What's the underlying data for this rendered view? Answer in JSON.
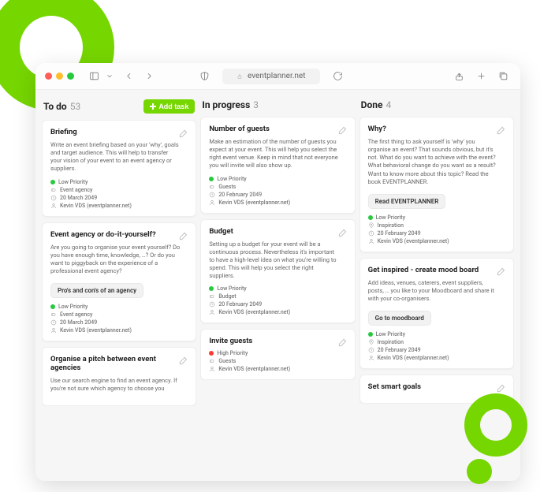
{
  "url": "eventplanner.net",
  "addTaskLabel": "Add task",
  "columns": [
    {
      "title": "To do",
      "count": 53,
      "showAdd": true,
      "cards": [
        {
          "title": "Briefing",
          "desc": "Write an event briefing based on your 'why', goals and target audience. This will help to transfer your vision of your event to an event agency or suppliers.",
          "priority": {
            "label": "Low Priority",
            "color": "green"
          },
          "tag": "Event agency",
          "date": "20 March 2049",
          "author": "Kevin VDS (eventplanner.net)"
        },
        {
          "title": "Event agency or do-it-yourself?",
          "desc": "Are you going to organise your event yourself? Do you have enough time, knowledge, …? Or do you want to piggyback on the experience of a professional event agency?",
          "action": "Pro's and con's of an agency",
          "priority": {
            "label": "Low Priority",
            "color": "green"
          },
          "tag": "Event agency",
          "date": "20 March 2049",
          "author": "Kevin VDS (eventplanner.net)"
        },
        {
          "title": "Organise a pitch between event agencies",
          "desc": "Use our search engine to find an event agency. If you're not sure which agency to choose you"
        }
      ]
    },
    {
      "title": "In progress",
      "count": 3,
      "showAdd": false,
      "cards": [
        {
          "title": "Number of guests",
          "desc": "Make an estimation of the number of guests you expect at your event. This will help you select the right event venue. Keep in mind that not everyone you will invite will also show up.",
          "priority": {
            "label": "Low Priority",
            "color": "green"
          },
          "tag": "Guests",
          "date": "20 February 2049",
          "author": "Kevin VDS (eventplanner.net)"
        },
        {
          "title": "Budget",
          "desc": "Setting up a budget for your event will be a continuous process. Nevertheless it's important to have a high-level idea on what you're willing to spend. This will help you select the right suppliers.",
          "priority": {
            "label": "Low Priority",
            "color": "green"
          },
          "tag": "Budget",
          "date": "20 February 2049",
          "author": "Kevin VDS (eventplanner.net)"
        },
        {
          "title": "Invite guests",
          "priority": {
            "label": "High Priority",
            "color": "red"
          },
          "tag": "Guests",
          "author": "Kevin VDS (eventplanner.net)"
        }
      ]
    },
    {
      "title": "Done",
      "count": 4,
      "showAdd": false,
      "cards": [
        {
          "title": "Why?",
          "desc": "The first thing to ask yourself is 'why' you organise an event? That sounds obvious, but it's not. What do you want to achieve with the event? What behavioral change do you want as a result? Want to know more about this topic? Read the book EVENTPLANNER.",
          "action": "Read EVENTPLANNER",
          "priority": {
            "label": "Low Priority",
            "color": "green"
          },
          "tag": "Inspiration",
          "date": "20 February 2049",
          "author": "Kevin VDS (eventplanner.net)"
        },
        {
          "title": "Get inspired - create mood board",
          "desc": "Add ideas, venues, caterers, event suppliers, posts, … you like to your Moodboard and share it with your co-organisers.",
          "action": "Go to moodboard",
          "priority": {
            "label": "Low Priority",
            "color": "green"
          },
          "tag": "Inspiration",
          "date": "20 February 2049",
          "author": "Kevin VDS (eventplanner.net)"
        },
        {
          "title": "Set smart goals"
        }
      ]
    }
  ]
}
